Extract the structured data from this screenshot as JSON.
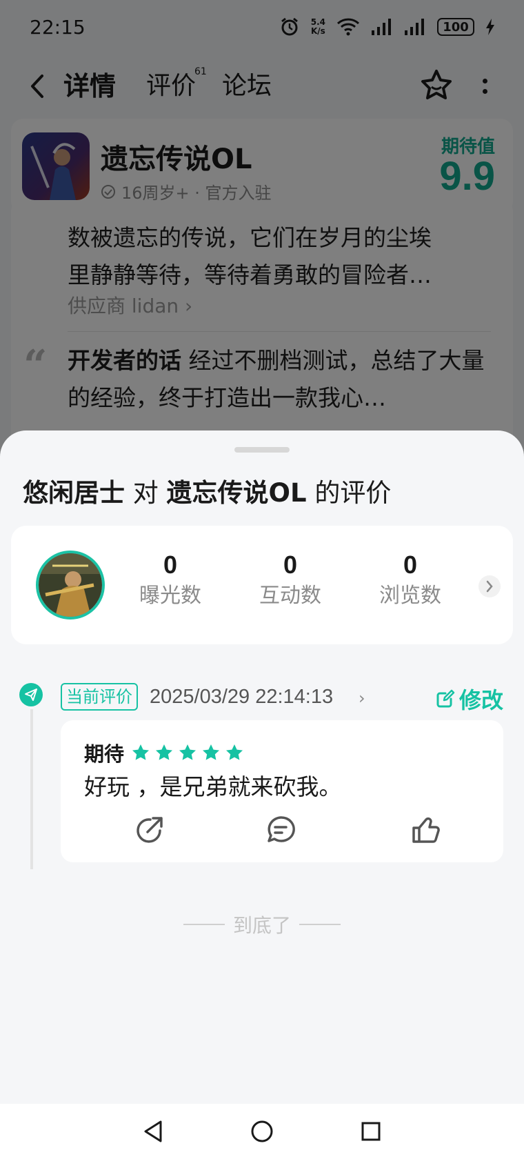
{
  "status_bar": {
    "time": "22:15",
    "net_speed_value": "5.4",
    "net_speed_unit": "K/s",
    "battery": "100"
  },
  "top_nav": {
    "tabs": [
      {
        "label": "详情"
      },
      {
        "label": "评价",
        "count": "61"
      },
      {
        "label": "论坛"
      }
    ]
  },
  "game": {
    "name": "遗忘传说OL",
    "meta": "16周岁+ · 官方入驻",
    "expect_label": "期待值",
    "expect_score": "9.9"
  },
  "background_content": {
    "intro_line1": "数被遗忘的传说，它们在岁月的尘埃",
    "intro_line2": "里静静等待，等待着勇敢的冒险者…",
    "supplier": "供应商 lidan",
    "dev_label": "开发者的话",
    "dev_text": "经过不删档测试，总结了大量的经验，终于打造出一款我心…"
  },
  "sheet": {
    "title_user": "悠闲居士",
    "title_mid": "对",
    "title_game": "遗忘传说OL",
    "title_tail": "的评价",
    "stats": [
      {
        "value": "0",
        "label": "曝光数"
      },
      {
        "value": "0",
        "label": "互动数"
      },
      {
        "value": "0",
        "label": "浏览数"
      }
    ],
    "review": {
      "badge": "当前评价",
      "timestamp": "2025/03/29 22:14:13",
      "edit_label": "修改",
      "rating_label": "期待",
      "stars": 5,
      "text": "好玩 ，是兄弟就来砍我。"
    },
    "end_text": "到底了"
  },
  "colors": {
    "accent": "#16c2a3",
    "overlay": "rgba(0,0,0,0.5)"
  }
}
